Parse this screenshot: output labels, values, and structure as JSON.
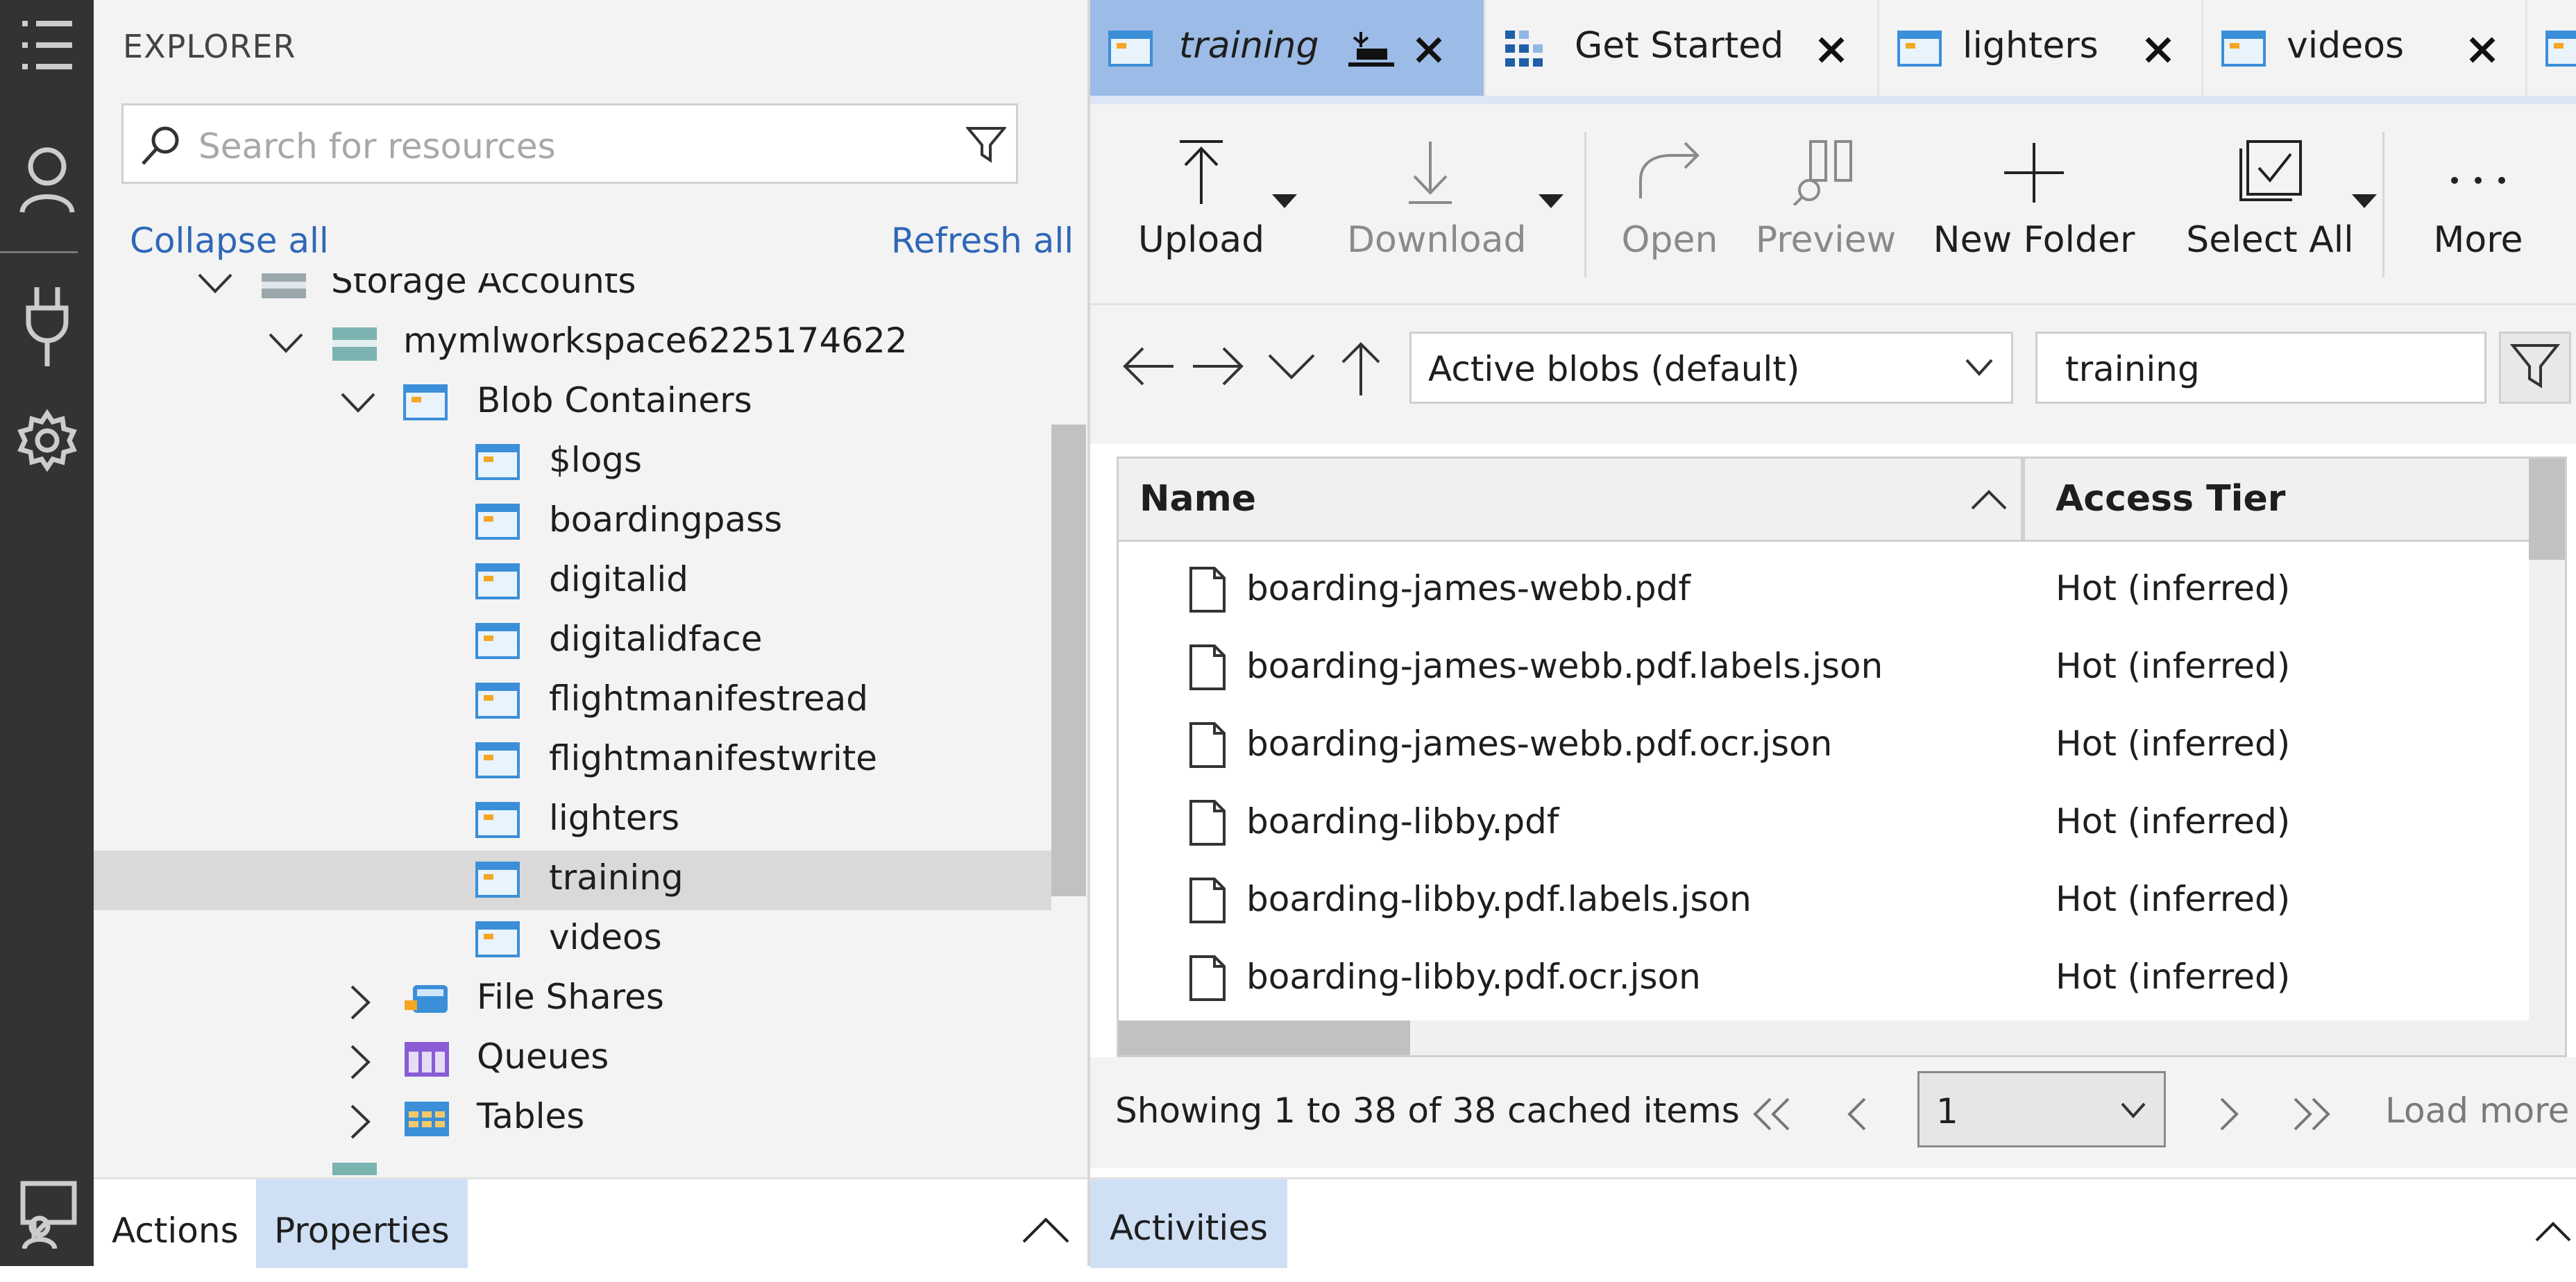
{
  "explorer": {
    "title": "EXPLORER",
    "search_placeholder": "Search for resources",
    "collapse_all": "Collapse all",
    "refresh_all": "Refresh all",
    "tree": [
      {
        "label": "Storage Accounts",
        "expanded": true,
        "icon": "storage-accounts-icon"
      },
      {
        "label": "mymlworkspace6225174622",
        "expanded": true,
        "icon": "storage-account-icon"
      },
      {
        "label": "Blob Containers",
        "expanded": true,
        "icon": "blob-containers-icon"
      },
      {
        "label": "$logs",
        "icon": "container-icon"
      },
      {
        "label": "boardingpass",
        "icon": "container-icon"
      },
      {
        "label": "digitalid",
        "icon": "container-icon"
      },
      {
        "label": "digitalidface",
        "icon": "container-icon"
      },
      {
        "label": "flightmanifestread",
        "icon": "container-icon"
      },
      {
        "label": "flightmanifestwrite",
        "icon": "container-icon"
      },
      {
        "label": "lighters",
        "icon": "container-icon"
      },
      {
        "label": "training",
        "icon": "container-icon",
        "selected": true
      },
      {
        "label": "videos",
        "icon": "container-icon"
      },
      {
        "label": "File Shares",
        "expanded": false,
        "icon": "file-shares-icon"
      },
      {
        "label": "Queues",
        "expanded": false,
        "icon": "queues-icon"
      },
      {
        "label": "Tables",
        "expanded": false,
        "icon": "tables-icon"
      }
    ],
    "bottom_tabs": {
      "actions": "Actions",
      "properties": "Properties",
      "active": "Properties"
    }
  },
  "tabs": [
    {
      "label": "training",
      "active": true,
      "icon": "container-icon"
    },
    {
      "label": "Get Started",
      "icon": "get-started-icon"
    },
    {
      "label": "lighters",
      "icon": "container-icon"
    },
    {
      "label": "videos",
      "icon": "container-icon"
    }
  ],
  "toolbar": {
    "upload": "Upload",
    "download": "Download",
    "open": "Open",
    "preview": "Preview",
    "new_folder": "New Folder",
    "select_all": "Select All",
    "more": "More"
  },
  "nav": {
    "blob_filter": "Active blobs (default)",
    "path": "training"
  },
  "grid": {
    "columns": {
      "name": "Name",
      "access_tier": "Access Tier"
    },
    "rows": [
      {
        "name": "boarding-james-webb.pdf",
        "tier": "Hot (inferred)"
      },
      {
        "name": "boarding-james-webb.pdf.labels.json",
        "tier": "Hot (inferred)"
      },
      {
        "name": "boarding-james-webb.pdf.ocr.json",
        "tier": "Hot (inferred)"
      },
      {
        "name": "boarding-libby.pdf",
        "tier": "Hot (inferred)"
      },
      {
        "name": "boarding-libby.pdf.labels.json",
        "tier": "Hot (inferred)"
      },
      {
        "name": "boarding-libby.pdf.ocr.json",
        "tier": "Hot (inferred)"
      }
    ]
  },
  "pager": {
    "status": "Showing 1 to 38 of 38 cached items",
    "page": "1",
    "load_more": "Load more"
  },
  "activities": {
    "label": "Activities"
  },
  "colors": {
    "activity_bar": "#333333",
    "active_tab": "#9cbbe6",
    "link": "#2f67b7",
    "selected_row": "#d9d9d9",
    "panel_tab_active": "#cfe0f5"
  }
}
